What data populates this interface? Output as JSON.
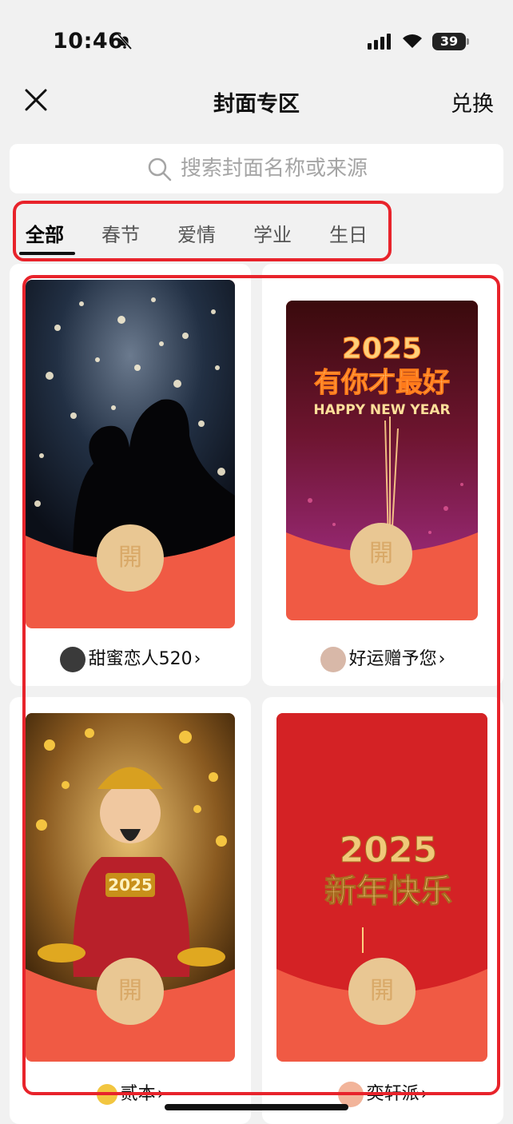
{
  "status": {
    "time": "10:46",
    "battery": "39"
  },
  "nav": {
    "title": "封面专区",
    "redeem": "兑换"
  },
  "search": {
    "placeholder": "搜索封面名称或来源"
  },
  "tabs": [
    "全部",
    "春节",
    "爱情",
    "学业",
    "生日"
  ],
  "open_glyph": "開",
  "covers": [
    {
      "source": "甜蜜恋人520"
    },
    {
      "source": "好运赠予您",
      "line1": "2025",
      "line2": "有你才最好",
      "line3": "HAPPY NEW YEAR"
    },
    {
      "source": "贰本",
      "badge": "2025"
    },
    {
      "source": "奕轩派",
      "line1": "2025",
      "line2": "新年快乐"
    }
  ],
  "colors": {
    "accent_red": "#e8232b",
    "envelope_red": "#f05a44",
    "open_gold": "#e9c793"
  }
}
